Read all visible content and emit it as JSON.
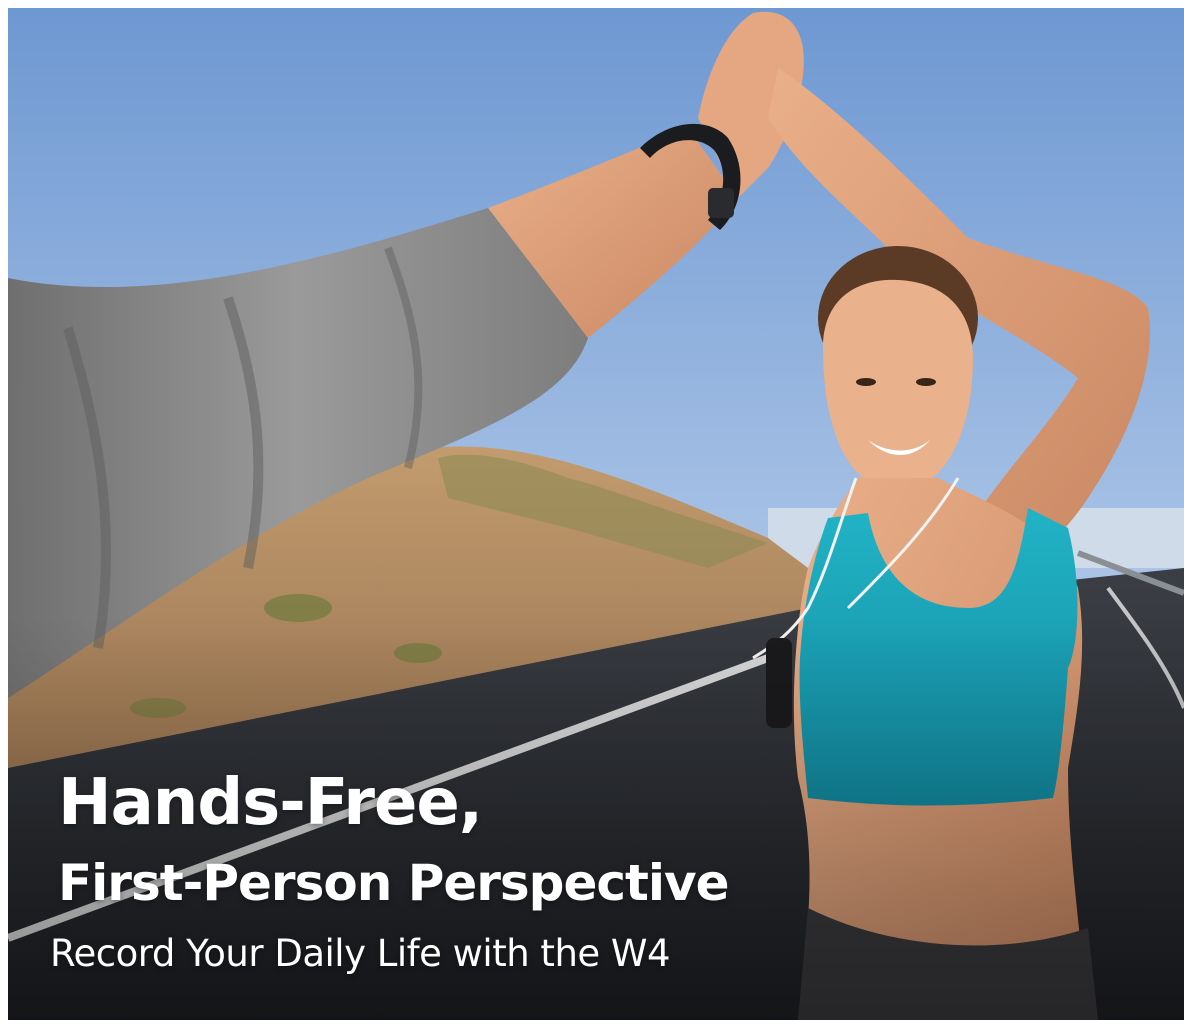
{
  "banner": {
    "headline_line1": "Hands-Free,",
    "headline_line2": "First-Person Perspective",
    "subheadline": "Record Your Daily Life with the W4"
  },
  "colors": {
    "sky_top": "#6f9ad3",
    "sky_bottom": "#c9daf0",
    "hill": "#b8926a",
    "road": "#2c2f34",
    "sleeve": "#8b8b8b",
    "skin": "#e0a57f",
    "sports_bra": "#1aa3b8",
    "text": "#ffffff"
  },
  "icons": {
    "wearable_band": "wristband-icon"
  }
}
